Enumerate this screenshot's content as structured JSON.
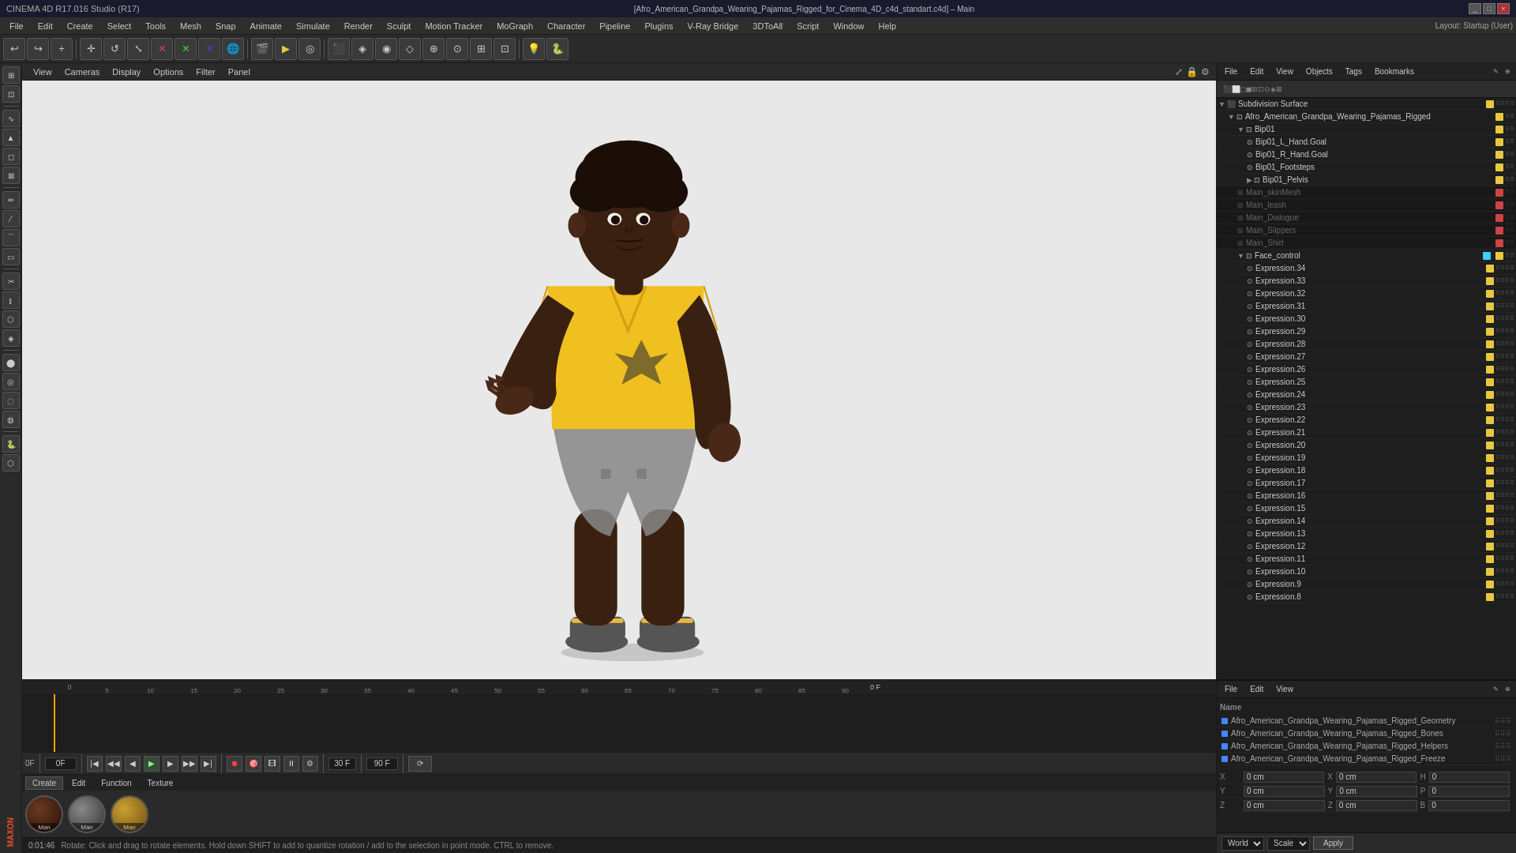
{
  "titlebar": {
    "title": "[Afro_American_Grandpa_Wearing_Pajamas_Rigged_for_Cinema_4D_c4d_standart.c4d] – Main",
    "app": "CINEMA 4D R17.016 Studio (R17)",
    "controls": [
      "_",
      "□",
      "×"
    ]
  },
  "menubar": {
    "items": [
      "File",
      "Edit",
      "Create",
      "Select",
      "Tools",
      "Mesh",
      "Snap",
      "Animate",
      "Simulate",
      "Render",
      "Sculpt",
      "Motion Tracker",
      "MoGraph",
      "Character",
      "Pipeline",
      "Plugins",
      "V-Ray Bridge",
      "3DToAll",
      "Script",
      "Window",
      "Help"
    ],
    "layout_label": "Layout: Startup (User)"
  },
  "viewport": {
    "top_menus": [
      "View",
      "Cameras",
      "Display",
      "Options",
      "Filter",
      "Panel"
    ]
  },
  "timeline": {
    "frame_current": "0 F",
    "frame_end": "90 F",
    "fps": "30 F",
    "frame_display": "0F",
    "time_display": "0:01:46",
    "ruler_marks": [
      "5",
      "10",
      "15",
      "20",
      "25",
      "30",
      "35",
      "40",
      "45",
      "50",
      "55",
      "60",
      "65",
      "70",
      "75",
      "80",
      "85",
      "90"
    ]
  },
  "materials": {
    "tabs": [
      "Create",
      "Edit",
      "Function",
      "Texture"
    ],
    "items": [
      "Man",
      "Man",
      "Man"
    ]
  },
  "statusbar": {
    "time": "0:01:46",
    "message": "Rotate: Click and drag to rotate elements. Hold down SHIFT to add to quantize rotation / add to the selection in point mode. CTRL to remove."
  },
  "obj_manager": {
    "header_tabs": [
      "File",
      "Edit",
      "View",
      "Objects",
      "Tags",
      "Bookmarks"
    ],
    "objects": [
      {
        "name": "Subdivision Surface",
        "indent": 0,
        "arrow": "▼",
        "icon": "⊞",
        "color": "#e8c840",
        "greyed": false
      },
      {
        "name": "Afro_American_Grandpa_Wearing_Pajamas_Rigged",
        "indent": 1,
        "arrow": "▼",
        "icon": "⊡",
        "color": "#e8c840",
        "greyed": false
      },
      {
        "name": "Bip01",
        "indent": 2,
        "arrow": "▼",
        "icon": "⊡",
        "color": "#e8c840",
        "greyed": false
      },
      {
        "name": "Bip01_L_Hand.Goal",
        "indent": 3,
        "arrow": "",
        "icon": "⊙",
        "color": "#e8c840",
        "greyed": false
      },
      {
        "name": "Bip01_R_Hand.Goal",
        "indent": 3,
        "arrow": "",
        "icon": "⊙",
        "color": "#e8c840",
        "greyed": false
      },
      {
        "name": "Bip01_Footsteps",
        "indent": 3,
        "arrow": "",
        "icon": "⊙",
        "color": "#e8c840",
        "greyed": false
      },
      {
        "name": "Bip01_Pelvis",
        "indent": 3,
        "arrow": "▶",
        "icon": "⊡",
        "color": "#e8c840",
        "greyed": false
      },
      {
        "name": "Main_skinMesh",
        "indent": 2,
        "arrow": "",
        "icon": "⊞",
        "color": "#cc4444",
        "greyed": true
      },
      {
        "name": "Main_leash",
        "indent": 2,
        "arrow": "",
        "icon": "⊞",
        "color": "#cc4444",
        "greyed": true
      },
      {
        "name": "Main_Dialogue",
        "indent": 2,
        "arrow": "",
        "icon": "⊞",
        "color": "#cc4444",
        "greyed": true
      },
      {
        "name": "Main_Slippers",
        "indent": 2,
        "arrow": "",
        "icon": "⊞",
        "color": "#cc4444",
        "greyed": true
      },
      {
        "name": "Main_Shirt",
        "indent": 2,
        "arrow": "",
        "icon": "⊞",
        "color": "#cc4444",
        "greyed": true
      },
      {
        "name": "Face_control",
        "indent": 2,
        "arrow": "▼",
        "icon": "⊡",
        "color": "#40ccff",
        "greyed": false
      },
      {
        "name": "Expression.34",
        "indent": 3,
        "arrow": "",
        "icon": "⊙",
        "color": "#e8c840",
        "greyed": false
      },
      {
        "name": "Expression.33",
        "indent": 3,
        "arrow": "",
        "icon": "⊙",
        "color": "#e8c840",
        "greyed": false
      },
      {
        "name": "Expression.32",
        "indent": 3,
        "arrow": "",
        "icon": "⊙",
        "color": "#e8c840",
        "greyed": false
      },
      {
        "name": "Expression.31",
        "indent": 3,
        "arrow": "",
        "icon": "⊙",
        "color": "#e8c840",
        "greyed": false
      },
      {
        "name": "Expression.30",
        "indent": 3,
        "arrow": "",
        "icon": "⊙",
        "color": "#e8c840",
        "greyed": false
      },
      {
        "name": "Expression.29",
        "indent": 3,
        "arrow": "",
        "icon": "⊙",
        "color": "#e8c840",
        "greyed": false
      },
      {
        "name": "Expression.28",
        "indent": 3,
        "arrow": "",
        "icon": "⊙",
        "color": "#e8c840",
        "greyed": false
      },
      {
        "name": "Expression.27",
        "indent": 3,
        "arrow": "",
        "icon": "⊙",
        "color": "#e8c840",
        "greyed": false
      },
      {
        "name": "Expression.26",
        "indent": 3,
        "arrow": "",
        "icon": "⊙",
        "color": "#e8c840",
        "greyed": false
      },
      {
        "name": "Expression.25",
        "indent": 3,
        "arrow": "",
        "icon": "⊙",
        "color": "#e8c840",
        "greyed": false
      },
      {
        "name": "Expression.24",
        "indent": 3,
        "arrow": "",
        "icon": "⊙",
        "color": "#e8c840",
        "greyed": false
      },
      {
        "name": "Expression.23",
        "indent": 3,
        "arrow": "",
        "icon": "⊙",
        "color": "#e8c840",
        "greyed": false
      },
      {
        "name": "Expression.22",
        "indent": 3,
        "arrow": "",
        "icon": "⊙",
        "color": "#e8c840",
        "greyed": false
      },
      {
        "name": "Expression.21",
        "indent": 3,
        "arrow": "",
        "icon": "⊙",
        "color": "#e8c840",
        "greyed": false
      },
      {
        "name": "Expression.20",
        "indent": 3,
        "arrow": "",
        "icon": "⊙",
        "color": "#e8c840",
        "greyed": false
      },
      {
        "name": "Expression.19",
        "indent": 3,
        "arrow": "",
        "icon": "⊙",
        "color": "#e8c840",
        "greyed": false
      },
      {
        "name": "Expression.18",
        "indent": 3,
        "arrow": "",
        "icon": "⊙",
        "color": "#e8c840",
        "greyed": false
      },
      {
        "name": "Expression.17",
        "indent": 3,
        "arrow": "",
        "icon": "⊙",
        "color": "#e8c840",
        "greyed": false
      },
      {
        "name": "Expression.16",
        "indent": 3,
        "arrow": "",
        "icon": "⊙",
        "color": "#e8c840",
        "greyed": false
      },
      {
        "name": "Expression.15",
        "indent": 3,
        "arrow": "",
        "icon": "⊙",
        "color": "#e8c840",
        "greyed": false
      },
      {
        "name": "Expression.14",
        "indent": 3,
        "arrow": "",
        "icon": "⊙",
        "color": "#e8c840",
        "greyed": false
      },
      {
        "name": "Expression.13",
        "indent": 3,
        "arrow": "",
        "icon": "⊙",
        "color": "#e8c840",
        "greyed": false
      },
      {
        "name": "Expression.12",
        "indent": 3,
        "arrow": "",
        "icon": "⊙",
        "color": "#e8c840",
        "greyed": false
      },
      {
        "name": "Expression.11",
        "indent": 3,
        "arrow": "",
        "icon": "⊙",
        "color": "#e8c840",
        "greyed": false
      },
      {
        "name": "Expression.10",
        "indent": 3,
        "arrow": "",
        "icon": "⊙",
        "color": "#e8c840",
        "greyed": false
      },
      {
        "name": "Expression.9",
        "indent": 3,
        "arrow": "",
        "icon": "⊙",
        "color": "#e8c840",
        "greyed": false
      },
      {
        "name": "Expression.8",
        "indent": 3,
        "arrow": "",
        "icon": "⊙",
        "color": "#e8c840",
        "greyed": false
      }
    ]
  },
  "attr_manager": {
    "header_tabs": [
      "File",
      "Edit",
      "View"
    ],
    "col_header": "Name",
    "scene_objects": [
      {
        "name": "Afro_American_Grandpa_Wearing_Pajamas_Rigged_Geometry",
        "color": "#4488ff"
      },
      {
        "name": "Afro_American_Grandpa_Wearing_Pajamas_Rigged_Bones",
        "color": "#4488ff"
      },
      {
        "name": "Afro_American_Grandpa_Wearing_Pajamas_Rigged_Helpers",
        "color": "#4488ff"
      },
      {
        "name": "Afro_American_Grandpa_Wearing_Pajamas_Rigged_Freeze",
        "color": "#4488ff"
      }
    ],
    "coords": {
      "x_label": "X",
      "x_val": "0 cm",
      "x2_val": "0 cm",
      "h_label": "H",
      "h_val": "0",
      "y_label": "Y",
      "y_val": "0 cm",
      "y2_val": "0 cm",
      "p_label": "P",
      "p_val": "0",
      "z_label": "Z",
      "z_val": "0 cm",
      "z2_val": "0 cm",
      "b_label": "B",
      "b_val": "0"
    },
    "world_label": "World",
    "scale_label": "Scale",
    "apply_label": "Apply"
  }
}
